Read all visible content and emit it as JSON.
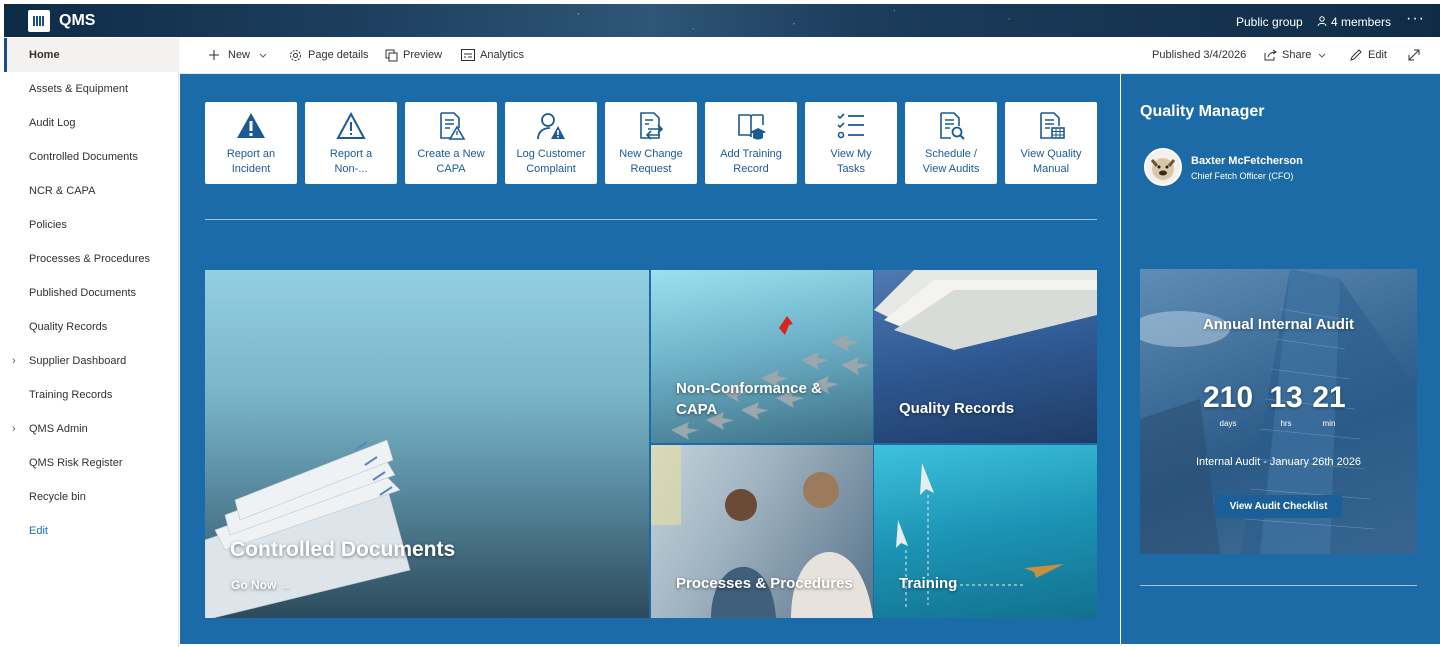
{
  "suite": {
    "site_title": "QMS",
    "group_type": "Public group",
    "members": "4 members",
    "more": "···"
  },
  "nav": {
    "items": [
      {
        "label": "Home"
      },
      {
        "label": "Assets & Equipment"
      },
      {
        "label": "Audit Log"
      },
      {
        "label": "Controlled Documents"
      },
      {
        "label": "NCR & CAPA"
      },
      {
        "label": "Policies"
      },
      {
        "label": "Processes & Procedures"
      },
      {
        "label": "Published Documents"
      },
      {
        "label": "Quality Records"
      },
      {
        "label": "Supplier Dashboard"
      },
      {
        "label": "Training Records"
      },
      {
        "label": "QMS Admin"
      },
      {
        "label": "QMS Risk Register"
      },
      {
        "label": "Recycle bin"
      },
      {
        "label": "Edit"
      }
    ]
  },
  "commandbar": {
    "new": "New",
    "page_details": "Page details",
    "preview": "Preview",
    "analytics": "Analytics",
    "published": "Published 3/4/2026",
    "share": "Share",
    "edit": "Edit"
  },
  "quicklinks": [
    {
      "line1": "Report an",
      "line2": "Incident",
      "icon": "warning-icon"
    },
    {
      "line1": "Report a",
      "line2": "Non-...",
      "icon": "warning-outline-icon"
    },
    {
      "line1": "Create a New",
      "line2": "CAPA",
      "icon": "document-warning-icon"
    },
    {
      "line1": "Log Customer",
      "line2": "Complaint",
      "icon": "person-warning-icon"
    },
    {
      "line1": "New Change",
      "line2": "Request",
      "icon": "document-arrows-icon"
    },
    {
      "line1": "Add Training",
      "line2": "Record",
      "icon": "book-cap-icon"
    },
    {
      "line1": "View My",
      "line2": "Tasks",
      "icon": "task-list-icon"
    },
    {
      "line1": "Schedule /",
      "line2": "View Audits",
      "icon": "document-search-icon"
    },
    {
      "line1": "View Quality",
      "line2": "Manual",
      "icon": "document-table-icon"
    }
  ],
  "hero": {
    "controlled_title": "Controlled Documents",
    "go_now": "Go Now",
    "ncr_title_1": "Non-Conformance &",
    "ncr_title_2": "CAPA",
    "quality_records": "Quality Records",
    "processes": "Processes & Procedures",
    "training": "Training"
  },
  "sidebar": {
    "manager_heading": "Quality Manager",
    "person_name": "Baxter McFetcherson",
    "person_role": "Chief Fetch Officer (CFO)",
    "audit": {
      "title": "Annual Internal Audit",
      "days": "210",
      "days_label": "days",
      "hrs": "13",
      "hrs_label": "hrs",
      "min": "21",
      "min_label": "min",
      "date_text": "Internal Audit - January 26th 2026",
      "button": "View Audit Checklist"
    }
  },
  "colors": {
    "accent": "#1b6ba9",
    "brand_dark": "#1b5a94"
  }
}
